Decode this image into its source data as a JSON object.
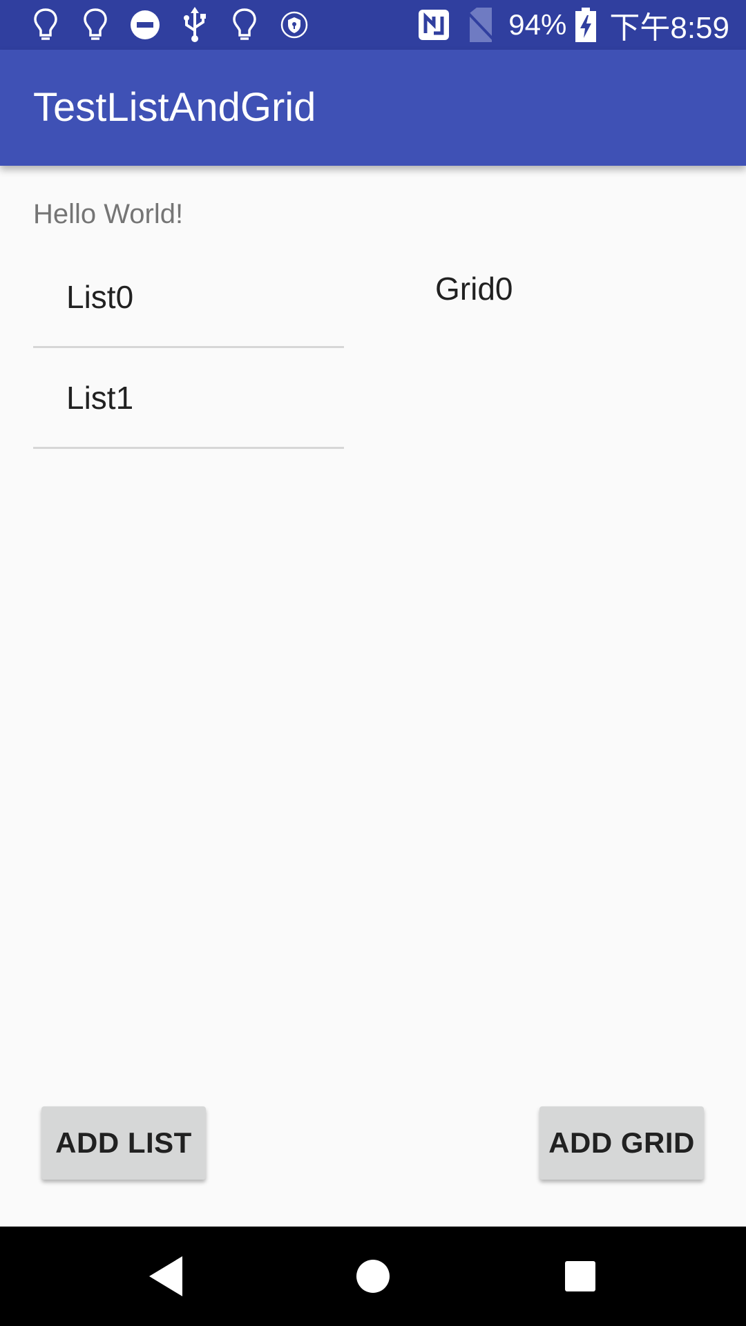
{
  "status_bar": {
    "battery_text": "94%",
    "time": "下午8:59",
    "icons": [
      "bulb-icon",
      "bulb-icon",
      "do-not-disturb-icon",
      "usb-icon",
      "bulb-icon",
      "vpn-shield-icon",
      "nfc-icon",
      "no-sim-icon",
      "battery-charging-icon"
    ]
  },
  "app_bar": {
    "title": "TestListAndGrid"
  },
  "main": {
    "hello_text": "Hello World!",
    "list_items": [
      "List0",
      "List1"
    ],
    "grid_items": [
      "Grid0"
    ]
  },
  "buttons": {
    "add_list": "ADD LIST",
    "add_grid": "ADD GRID"
  },
  "nav_bar": {
    "icons": [
      "back-icon",
      "home-icon",
      "recents-icon"
    ]
  },
  "colors": {
    "status_bar": "#303f9f",
    "app_bar": "#3f51b5",
    "background": "#fafafa",
    "button": "#d6d7d7"
  }
}
